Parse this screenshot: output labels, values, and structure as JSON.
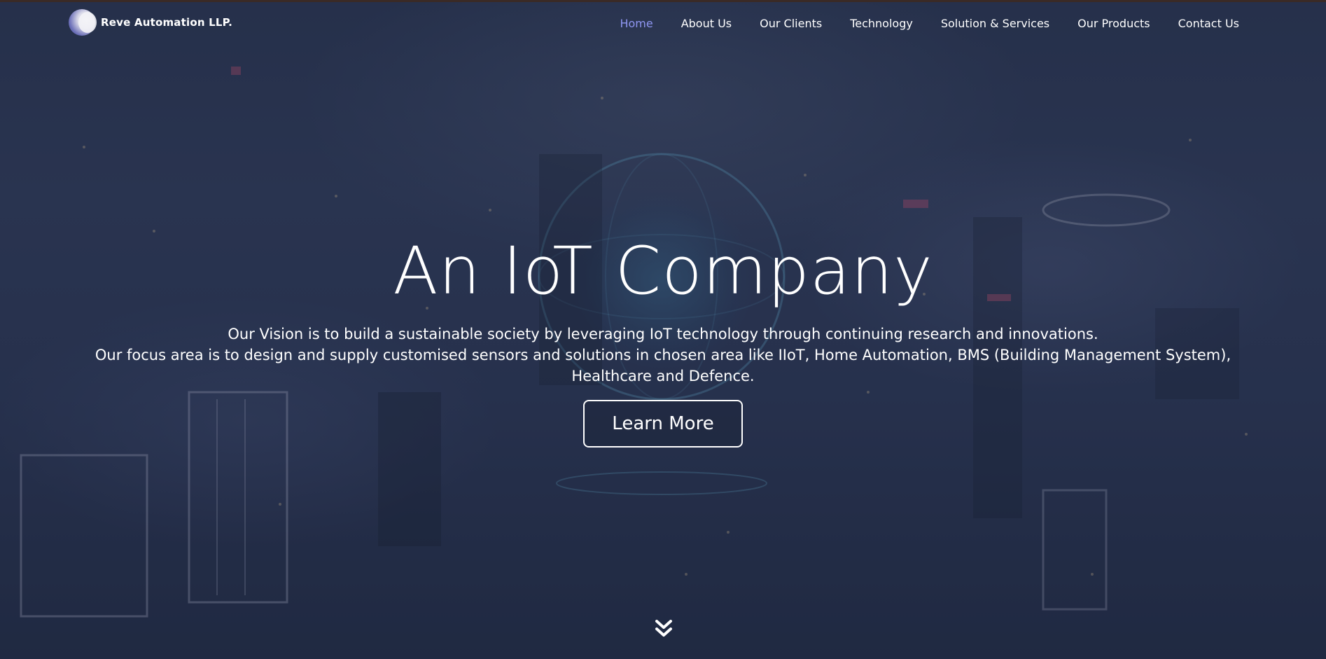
{
  "brand": {
    "name": "Reve Automation LLP.",
    "logo_icon": "reve-logo-icon"
  },
  "nav": {
    "items": [
      {
        "label": "Home",
        "active": true
      },
      {
        "label": "About Us",
        "active": false
      },
      {
        "label": "Our Clients",
        "active": false
      },
      {
        "label": "Technology",
        "active": false
      },
      {
        "label": "Solution & Services",
        "active": false
      },
      {
        "label": "Our Products",
        "active": false
      },
      {
        "label": "Contact Us",
        "active": false
      }
    ],
    "active_color": "#8f96f2"
  },
  "hero": {
    "title": "An IoT Company",
    "vision": "Our Vision is to build a sustainable society by leveraging IoT technology through continuing research and innovations.",
    "focus": "Our focus area is to design and supply customised sensors and solutions in chosen area like IIoT, Home Automation, BMS (Building Management System), Healthcare and Defence.",
    "button_label": "Learn More",
    "scroll_icon": "double-chevron-down-icon",
    "background_image": "night-city-aerial-with-globe"
  }
}
